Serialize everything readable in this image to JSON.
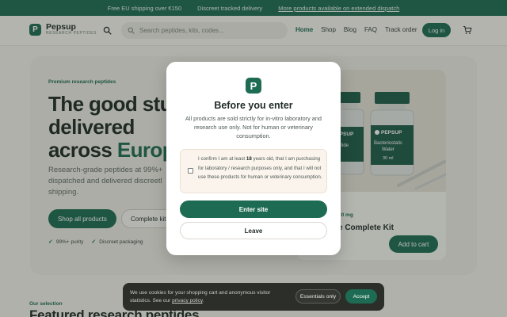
{
  "announcement": {
    "items": [
      "Free EU shipping over €150",
      "Discreet tracked delivery"
    ],
    "link": "More products available on extended dispatch"
  },
  "header": {
    "brand": "Pepsup",
    "tagline": "RESEARCH PEPTIDES",
    "logo_letter": "P",
    "search_placeholder": "Search peptides, kits, codes...",
    "nav": [
      "Home",
      "Shop",
      "Blog",
      "FAQ",
      "Track order"
    ],
    "active_nav": "Home",
    "login_label": "Log in"
  },
  "hero": {
    "eyebrow": "Premium research peptides",
    "title_line1": "The good stu",
    "title_line2": "delivered",
    "title_line3_plain": "across ",
    "title_line3_accent": "Europ",
    "subtitle": "Research-grade peptides at 99%+ dispatched and delivered discreetl shipping.",
    "shop_button": "Shop all products",
    "kit_button": "Complete kit",
    "features": [
      "99%+ purity",
      "Discreet packaging"
    ]
  },
  "product": {
    "badge": "20 mg",
    "title": "e Complete Kit",
    "cart_button": "Add to cart",
    "vial_brand": "PEPSUP",
    "vial_left_label": "atrutide",
    "vial_right_label_1": "Bacteriostatic",
    "vial_right_label_2": "Water",
    "vial_right_volume": "30 ml"
  },
  "section": {
    "eyebrow": "Our selection",
    "title": "Featured research peptides"
  },
  "modal": {
    "logo_letter": "P",
    "title": "Before you enter",
    "body": "All products are sold strictly for in-vitro laboratory and research use only. Not for human or veterinary consumption.",
    "confirm_prefix": "I confirm I am at least ",
    "confirm_age": "18",
    "confirm_suffix": " years old, that I am purchasing for laboratory / research purposes only, and that I will not use these products for human or veterinary consumption.",
    "confirm_checked": false,
    "enter_label": "Enter site",
    "leave_label": "Leave"
  },
  "cookie": {
    "text": "We use cookies for your shopping cart and anonymous visitor statistics. See our ",
    "link": "privacy policy",
    "text_end": ".",
    "essentials_label": "Essentials only",
    "accept_label": "Accept"
  },
  "colors": {
    "brand_green": "#1d6b52",
    "page_bg": "#f3f1ea",
    "cookie_bg": "#2c2e2a"
  }
}
